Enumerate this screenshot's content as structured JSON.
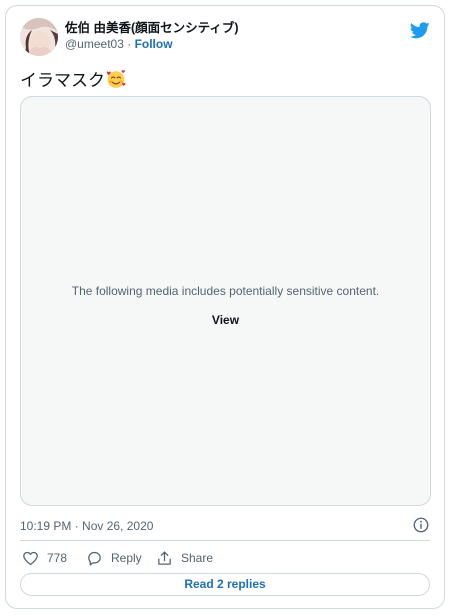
{
  "user": {
    "display_name": "佐伯 由美香(顔面センシティブ)",
    "handle": "@umeet03",
    "separator": " · ",
    "follow_label": "Follow",
    "avatar_icon": "profile-photo"
  },
  "tweet": {
    "text": "イラマスク",
    "emoji": "smiling-face-with-hearts-emoji",
    "media": {
      "warning": "The following media includes potentially sensitive content.",
      "view_label": "View"
    },
    "timestamp": "10:19 PM · Nov 26, 2020"
  },
  "actions": {
    "like_count": "778",
    "reply_label": "Reply",
    "share_label": "Share",
    "read_replies_label": "Read 2 replies"
  },
  "colors": {
    "brand": "#1d9bf0",
    "link": "#1d6fb8",
    "border": "#cfd9de",
    "muted_text": "#536471",
    "media_bg": "#f6f7f7"
  }
}
